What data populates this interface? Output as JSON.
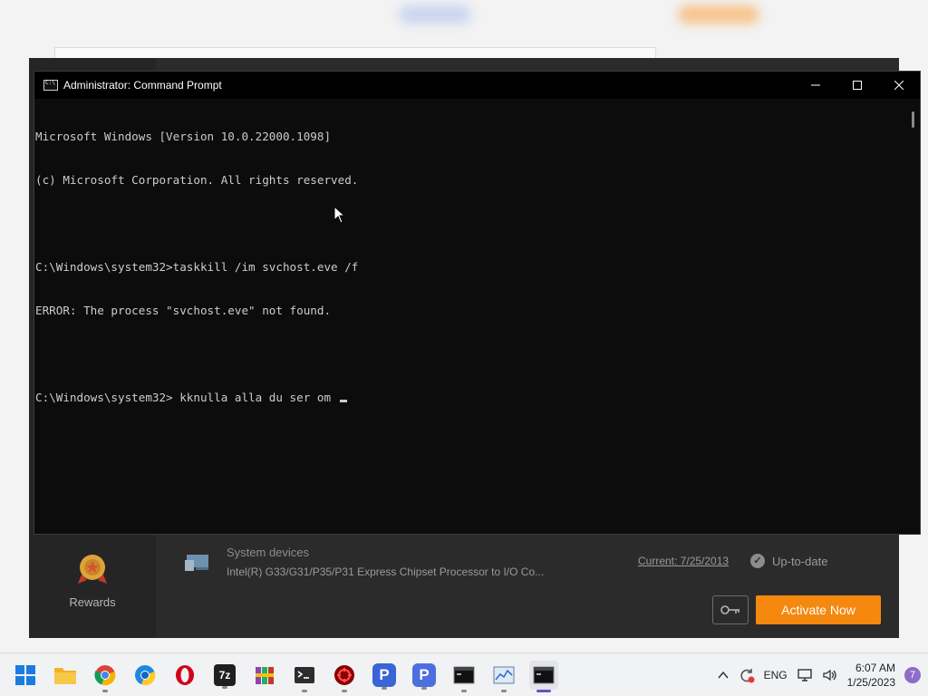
{
  "cmd": {
    "title": "Administrator: Command Prompt",
    "lines": [
      "Microsoft Windows [Version 10.0.22000.1098]",
      "(c) Microsoft Corporation. All rights reserved.",
      "",
      "C:\\Windows\\system32>taskkill /im svchost.eve /f",
      "ERROR: The process \"svchost.eve\" not found.",
      "",
      "C:\\Windows\\system32> kknulla alla du ser om "
    ]
  },
  "background_app": {
    "rewards_label": "Rewards",
    "device_title": "System devices",
    "device_desc": "Intel(R) G33/G31/P35/P31 Express Chipset Processor to I/O Co...",
    "current": "Current: 7/25/2013",
    "status": "Up-to-date",
    "activate_label": "Activate Now",
    "accent_color": "#f5880f"
  },
  "taskbar": {
    "apps": [
      {
        "name": "start-icon"
      },
      {
        "name": "file-explorer-icon"
      },
      {
        "name": "chrome-icon"
      },
      {
        "name": "chromium-icon"
      },
      {
        "name": "opera-icon"
      },
      {
        "name": "7zip-icon",
        "text": "7z"
      },
      {
        "name": "winrar-icon"
      },
      {
        "name": "terminal-icon"
      },
      {
        "name": "security-tool-icon"
      },
      {
        "name": "p-app-icon",
        "text": "P"
      },
      {
        "name": "p-app-2-icon",
        "text": "P"
      },
      {
        "name": "console-icon"
      },
      {
        "name": "monitor-icon"
      },
      {
        "name": "command-prompt-icon"
      }
    ],
    "language": "ENG",
    "time": "6:07 AM",
    "date": "1/25/2023",
    "notifications": "7"
  }
}
